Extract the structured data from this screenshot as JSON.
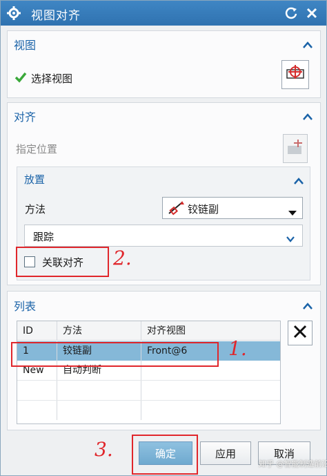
{
  "window": {
    "title": "视图对齐"
  },
  "view_section": {
    "title": "视图",
    "select_label": "选择视图"
  },
  "align_section": {
    "title": "对齐",
    "specify_position_label": "指定位置",
    "placement": {
      "title": "放置",
      "method_label": "方法",
      "method_value": "铰链副",
      "tracking_value": "跟踪",
      "associative_align_label": "关联对齐",
      "associative_align_checked": false
    }
  },
  "list_section": {
    "title": "列表",
    "columns": [
      "ID",
      "方法",
      "对齐视图"
    ],
    "rows": [
      {
        "id": "1",
        "method": "铰链副",
        "view": "Front@6",
        "selected": true
      },
      {
        "id": "New",
        "method": "自动判断",
        "view": ""
      }
    ]
  },
  "annotations": {
    "step1": "1.",
    "step2": "2.",
    "step3": "3."
  },
  "buttons": {
    "ok": "确定",
    "apply": "应用",
    "cancel": "取消"
  },
  "watermark": "知乎 @智能制造前沿",
  "colors": {
    "titlebar": "#2f72b0",
    "section_title": "#1b63a8",
    "selection": "#85b8d8",
    "annotation": "#e0262b"
  }
}
